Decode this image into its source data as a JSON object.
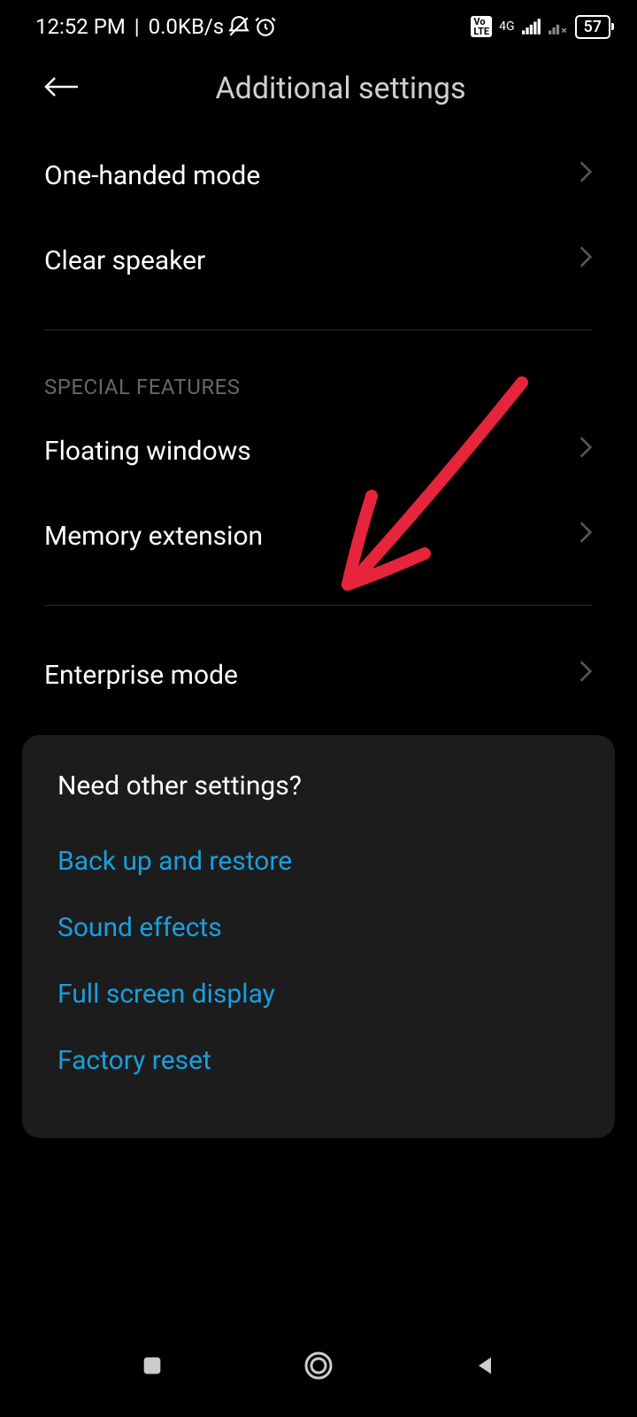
{
  "status": {
    "time": "12:52 PM",
    "data_rate": "0.0KB/s",
    "network_label": "4G",
    "battery_level": "57"
  },
  "header": {
    "title": "Additional settings"
  },
  "sections": {
    "general": [
      {
        "label": "One-handed mode"
      },
      {
        "label": "Clear speaker"
      }
    ],
    "special_features_header": "SPECIAL FEATURES",
    "special_features": [
      {
        "label": "Floating windows"
      },
      {
        "label": "Memory extension"
      }
    ],
    "other": [
      {
        "label": "Enterprise mode"
      }
    ]
  },
  "suggestions": {
    "title": "Need other settings?",
    "links": [
      {
        "label": "Back up and restore"
      },
      {
        "label": "Sound effects"
      },
      {
        "label": "Full screen display"
      },
      {
        "label": "Factory reset"
      }
    ]
  },
  "annotation": {
    "color": "#e6243b"
  }
}
